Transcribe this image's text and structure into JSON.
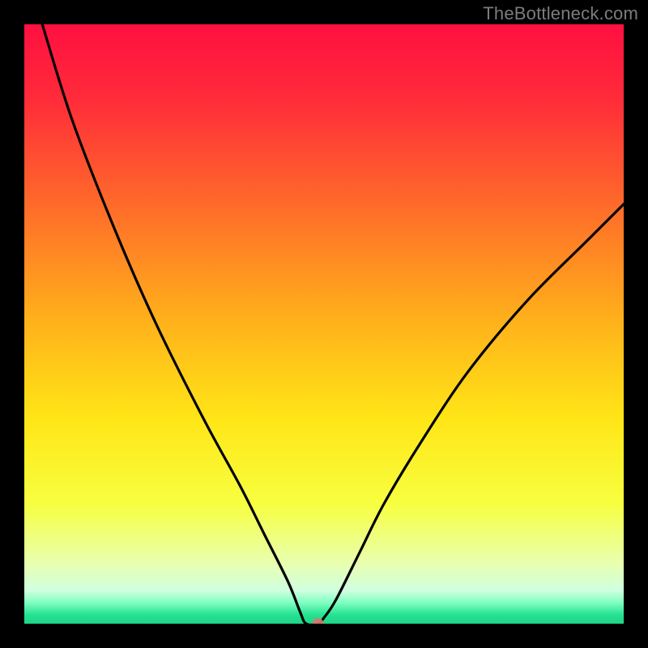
{
  "watermark": "TheBottleneck.com",
  "chart_data": {
    "type": "line",
    "title": "",
    "xlabel": "",
    "ylabel": "",
    "xlim": [
      0,
      100
    ],
    "ylim": [
      0,
      100
    ],
    "grid": false,
    "series": [
      {
        "name": "bottleneck-curve",
        "x": [
          3,
          8,
          15,
          22,
          30,
          36,
          40,
          44,
          46,
          47,
          49,
          50,
          52,
          56,
          60,
          66,
          74,
          84,
          94,
          100
        ],
        "values": [
          100,
          84,
          66,
          50,
          34,
          23,
          15,
          7,
          2,
          0,
          0,
          1,
          4,
          12,
          20,
          30,
          42,
          54,
          64,
          70
        ]
      }
    ],
    "marker": {
      "x": 49,
      "y": 0,
      "name": "optimal-point"
    },
    "optimal_band_y": [
      0,
      4
    ],
    "gradient_stops": [
      {
        "offset": 0.0,
        "color": "#ff1040"
      },
      {
        "offset": 0.12,
        "color": "#ff2a3a"
      },
      {
        "offset": 0.3,
        "color": "#ff6a2a"
      },
      {
        "offset": 0.5,
        "color": "#ffb31a"
      },
      {
        "offset": 0.66,
        "color": "#ffe617"
      },
      {
        "offset": 0.8,
        "color": "#f7ff40"
      },
      {
        "offset": 0.9,
        "color": "#e8ffb0"
      },
      {
        "offset": 0.945,
        "color": "#cfffe0"
      },
      {
        "offset": 0.965,
        "color": "#7fffc0"
      },
      {
        "offset": 0.985,
        "color": "#26e292"
      },
      {
        "offset": 1.0,
        "color": "#1ed488"
      }
    ]
  }
}
